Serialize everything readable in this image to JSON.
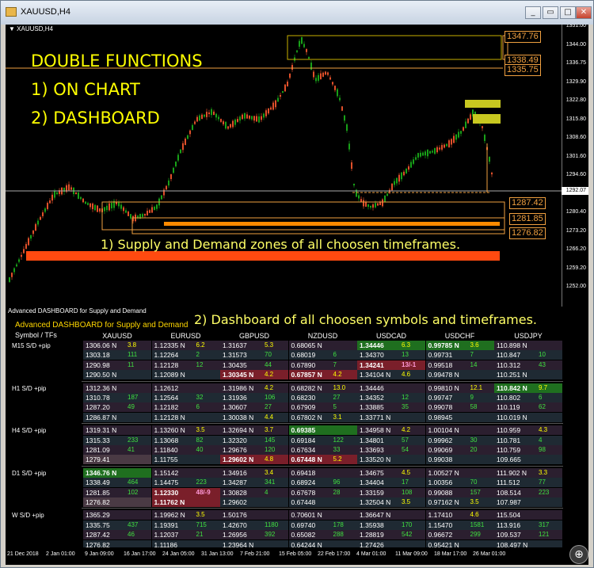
{
  "window": {
    "title": "XAUUSD,H4",
    "minimize": "_",
    "maximize": "□",
    "restore": "▭",
    "close": "✕"
  },
  "chart": {
    "symbol_label": "XAUUSD,H4",
    "headline": [
      "DOUBLE FUNCTIONS",
      "1) ON CHART",
      "2) DASHBOARD"
    ],
    "supply_caption": "1) Supply and Demand zones of all choosen timeframes.",
    "price_ticks": [
      "1351.00",
      "1344.00",
      "1336.75",
      "1329.90",
      "1322.80",
      "1315.80",
      "1308.60",
      "1301.60",
      "1294.60",
      "1287.40",
      "1280.40",
      "1273.20",
      "1266.20",
      "1259.20",
      "1252.00"
    ],
    "current_price": "1292.07",
    "zone_labels": {
      "top_a": "1347.76",
      "top_b": "1338.49",
      "top_c": "1335.75",
      "mid_a": "1287.42",
      "mid_b": "1281.85",
      "mid_c": "1276.82"
    },
    "colors": {
      "up": "#18a018",
      "down": "#e0502a",
      "zone": "#f0a040",
      "bar": "#ff4a10",
      "text": "#ffff00"
    }
  },
  "dashboard": {
    "window_title": "Advanced DASHBOARD for Supply and Demand",
    "header": "Advanced  DASHBOARD for Supply and Demand",
    "subheader": "Symbol / TFs",
    "caption": "2) Dashboard of all choosen symbols and timeframes.",
    "symbols": [
      "XAUUSD",
      "EURUSD",
      "GBPUSD",
      "NZDUSD",
      "USDCAD",
      "USDCHF",
      "USDJPY"
    ],
    "timeframes": [
      {
        "label": "M15 S/D +pip",
        "rows": [
          [
            [
              "1306.06 N",
              "3.8",
              "y",
              ""
            ],
            [
              "1.12335 N",
              "6.2",
              "y",
              ""
            ],
            [
              "1.31637",
              "5.3",
              "y",
              ""
            ],
            [
              "0.68065 N",
              "",
              "",
              " "
            ],
            [
              "1.34446",
              "6.3",
              "y",
              "green"
            ],
            [
              "0.99785 N",
              "3.6",
              "y",
              "green"
            ],
            [
              "110.898 N",
              "",
              "",
              " "
            ]
          ],
          [
            [
              "1303.18",
              "111",
              "",
              ""
            ],
            [
              "1.12264",
              "2",
              "",
              ""
            ],
            [
              "1.31573",
              "70",
              "",
              ""
            ],
            [
              "0.68019",
              "6",
              "",
              ""
            ],
            [
              "1.34370",
              "13",
              "",
              ""
            ],
            [
              "0.99731",
              "7",
              "",
              ""
            ],
            [
              "110.847",
              "10",
              "",
              ""
            ]
          ],
          [
            [
              "1290.98",
              "11",
              "",
              ""
            ],
            [
              "1.12128",
              "12",
              "",
              ""
            ],
            [
              "1.30435",
              "44",
              "",
              ""
            ],
            [
              "0.67890",
              "7",
              "",
              ""
            ],
            [
              "1.34241",
              "13/-1",
              "p",
              "red"
            ],
            [
              "0.99518",
              "14",
              "",
              ""
            ],
            [
              "110.312",
              "43",
              "",
              ""
            ]
          ],
          [
            [
              "1290.50 N",
              "",
              "",
              " "
            ],
            [
              "1.12089 N",
              "",
              "",
              " "
            ],
            [
              "1.30345 N",
              "4.2",
              "y",
              "red"
            ],
            [
              "0.67857 N",
              "4.2",
              "y",
              "red"
            ],
            [
              "1.34104 N",
              "4.6",
              "y",
              ""
            ],
            [
              "0.99478 N",
              "",
              "",
              " "
            ],
            [
              "110.251 N",
              "",
              "",
              " "
            ]
          ]
        ]
      },
      {
        "label": "H1 S/D +pip",
        "rows": [
          [
            [
              "1312.36 N",
              "",
              "",
              " "
            ],
            [
              "1.12612",
              "",
              "",
              " "
            ],
            [
              "1.31986 N",
              "4.2",
              "y",
              ""
            ],
            [
              "0.68282 N",
              "13.0",
              "y",
              ""
            ],
            [
              "1.34446",
              "",
              "",
              " "
            ],
            [
              "0.99810 N",
              "12.1",
              "y",
              ""
            ],
            [
              "110.842 N",
              "9.7",
              "y",
              "green"
            ]
          ],
          [
            [
              "1310.78",
              "187",
              "",
              ""
            ],
            [
              "1.12564",
              "32",
              "",
              ""
            ],
            [
              "1.31936",
              "106",
              "",
              ""
            ],
            [
              "0.68230",
              "27",
              "",
              ""
            ],
            [
              "1.34352",
              "12",
              "",
              ""
            ],
            [
              "0.99747",
              "9",
              "",
              ""
            ],
            [
              "110.802",
              "6",
              "",
              ""
            ]
          ],
          [
            [
              "1287.20",
              "49",
              "",
              ""
            ],
            [
              "1.12182",
              "6",
              "",
              ""
            ],
            [
              "1.30607",
              "27",
              "",
              ""
            ],
            [
              "0.67909",
              "5",
              "",
              ""
            ],
            [
              "1.33885",
              "35",
              "",
              ""
            ],
            [
              "0.99078",
              "58",
              "",
              ""
            ],
            [
              "110.119",
              "62",
              "",
              ""
            ]
          ],
          [
            [
              "1286.87 N",
              "",
              "",
              " "
            ],
            [
              "1.12128 N",
              "",
              "",
              " "
            ],
            [
              "1.30038 N",
              "4.4",
              "y",
              ""
            ],
            [
              "0.67802 N",
              "3.1",
              "y",
              ""
            ],
            [
              "1.33771 N",
              "",
              "",
              " "
            ],
            [
              "0.98945",
              "",
              "",
              " "
            ],
            [
              "110.019 N",
              "",
              "",
              " "
            ]
          ]
        ]
      },
      {
        "label": "H4 S/D +pip",
        "rows": [
          [
            [
              "1319.31 N",
              "",
              "",
              " "
            ],
            [
              "1.13260 N",
              "3.5",
              "y",
              ""
            ],
            [
              "1.32694 N",
              "3.7",
              "y",
              ""
            ],
            [
              "0.69385",
              "",
              "",
              "green"
            ],
            [
              "1.34958 N",
              "4.2",
              "y",
              ""
            ],
            [
              "1.00104 N",
              "",
              "",
              " "
            ],
            [
              "110.959",
              "4.3",
              "y",
              ""
            ]
          ],
          [
            [
              "1315.33",
              "233",
              "",
              ""
            ],
            [
              "1.13068",
              "82",
              "",
              ""
            ],
            [
              "1.32320",
              "145",
              "",
              ""
            ],
            [
              "0.69184",
              "122",
              "",
              ""
            ],
            [
              "1.34801",
              "57",
              "",
              ""
            ],
            [
              "0.99962",
              "30",
              "",
              ""
            ],
            [
              "110.781",
              "4",
              "",
              ""
            ]
          ],
          [
            [
              "1281.09",
              "41",
              "",
              ""
            ],
            [
              "1.11840",
              "40",
              "",
              ""
            ],
            [
              "1.29676",
              "120",
              "",
              ""
            ],
            [
              "0.67634",
              "33",
              "",
              ""
            ],
            [
              "1.33693",
              "54",
              "",
              ""
            ],
            [
              "0.99069",
              "20",
              "",
              ""
            ],
            [
              "110.759",
              "98",
              "",
              ""
            ]
          ],
          [
            [
              "1279.41",
              "",
              "",
              "pale"
            ],
            [
              "1.11755",
              "",
              "",
              " "
            ],
            [
              "1.29602 N",
              "4.8",
              "y",
              "red"
            ],
            [
              "0.67448 N",
              "5.2",
              "y",
              "red"
            ],
            [
              "1.33520 N",
              "",
              "",
              " "
            ],
            [
              "0.99038",
              "",
              "",
              " "
            ],
            [
              "109.665",
              "",
              "",
              " "
            ]
          ]
        ]
      },
      {
        "label": "D1 S/D +pip",
        "rows": [
          [
            [
              "1346.76 N",
              "",
              "",
              "green"
            ],
            [
              "1.15142",
              "",
              "",
              " "
            ],
            [
              "1.34916",
              "3.4",
              "y",
              ""
            ],
            [
              "0.69418",
              "",
              "",
              " "
            ],
            [
              "1.34675",
              "4.5",
              "y",
              ""
            ],
            [
              "1.00527 N",
              "",
              "",
              " "
            ],
            [
              "111.902 N",
              "3.3",
              "y",
              ""
            ]
          ],
          [
            [
              "1338.49",
              "464",
              "",
              ""
            ],
            [
              "1.14475",
              "223",
              "",
              ""
            ],
            [
              "1.34287",
              "341",
              "",
              ""
            ],
            [
              "0.68924",
              "96",
              "",
              ""
            ],
            [
              "1.34404",
              "17",
              "",
              ""
            ],
            [
              "1.00356",
              "70",
              "",
              ""
            ],
            [
              "111.512",
              "77",
              "",
              ""
            ]
          ],
          [
            [
              "1281.85",
              "102",
              "",
              ""
            ],
            [
              "1.12330",
              "48/-9",
              "p",
              "red"
            ],
            [
              "1.30828",
              "4",
              "",
              ""
            ],
            [
              "0.67678",
              "28",
              "",
              ""
            ],
            [
              "1.33159",
              "108",
              "",
              ""
            ],
            [
              "0.99088",
              "157",
              "",
              ""
            ],
            [
              "108.514",
              "223",
              "",
              ""
            ]
          ],
          [
            [
              "1276.82",
              "",
              "",
              "pale"
            ],
            [
              "1.11762 N",
              "",
              "",
              "red"
            ],
            [
              "1.29602",
              "",
              "",
              " "
            ],
            [
              "0.67448",
              "",
              "",
              " "
            ],
            [
              "1.32504 N",
              "3.5",
              "y",
              ""
            ],
            [
              "0.97162 N",
              "3.5",
              "y",
              ""
            ],
            [
              "107.987",
              "",
              "",
              " "
            ]
          ]
        ]
      },
      {
        "label": "W S/D +pip",
        "rows": [
          [
            [
              "1365.29",
              "",
              "",
              " "
            ],
            [
              "1.19962 N",
              "3.5",
              "y",
              ""
            ],
            [
              "1.50176",
              "",
              "",
              " "
            ],
            [
              "0.70601 N",
              "",
              "",
              " "
            ],
            [
              "1.36647 N",
              "",
              "",
              " "
            ],
            [
              "1.17410",
              "4.6",
              "y",
              ""
            ],
            [
              "115.504",
              "",
              "",
              " "
            ]
          ],
          [
            [
              "1335.75",
              "437",
              "",
              ""
            ],
            [
              "1.19391",
              "715",
              "",
              ""
            ],
            [
              "1.42670",
              "1180",
              "",
              ""
            ],
            [
              "0.69740",
              "178",
              "",
              ""
            ],
            [
              "1.35938",
              "170",
              "",
              ""
            ],
            [
              "1.15470",
              "1581",
              "",
              ""
            ],
            [
              "113.916",
              "317",
              "",
              ""
            ]
          ],
          [
            [
              "1287.42",
              "46",
              "",
              ""
            ],
            [
              "1.12037",
              "21",
              "",
              ""
            ],
            [
              "1.26956",
              "392",
              "",
              ""
            ],
            [
              "0.65082",
              "288",
              "",
              ""
            ],
            [
              "1.28819",
              "542",
              "",
              ""
            ],
            [
              "0.96672",
              "299",
              "",
              ""
            ],
            [
              "109.537",
              "121",
              "",
              ""
            ]
          ],
          [
            [
              "1276.82",
              "",
              "",
              " "
            ],
            [
              "1.11186",
              "",
              "",
              " "
            ],
            [
              "1.23964 N",
              "",
              "",
              " "
            ],
            [
              "0.64244 N",
              "",
              "",
              " "
            ],
            [
              "1.27426",
              "",
              "",
              " "
            ],
            [
              "0.95421 N",
              "",
              "",
              " "
            ],
            [
              "108.497 N",
              "",
              "",
              " "
            ]
          ]
        ]
      }
    ]
  },
  "time_axis": [
    "21 Dec 2018",
    "2 Jan 01:00",
    "9 Jan 09:00",
    "16 Jan 17:00",
    "24 Jan 05:00",
    "31 Jan 13:00",
    "7 Feb 21:00",
    "15 Feb 05:00",
    "22 Feb 17:00",
    "4 Mar 01:00",
    "11 Mar 09:00",
    "18 Mar 17:00",
    "26 Mar 01:00"
  ],
  "icons": {
    "zoom": "zoom-in-icon"
  }
}
